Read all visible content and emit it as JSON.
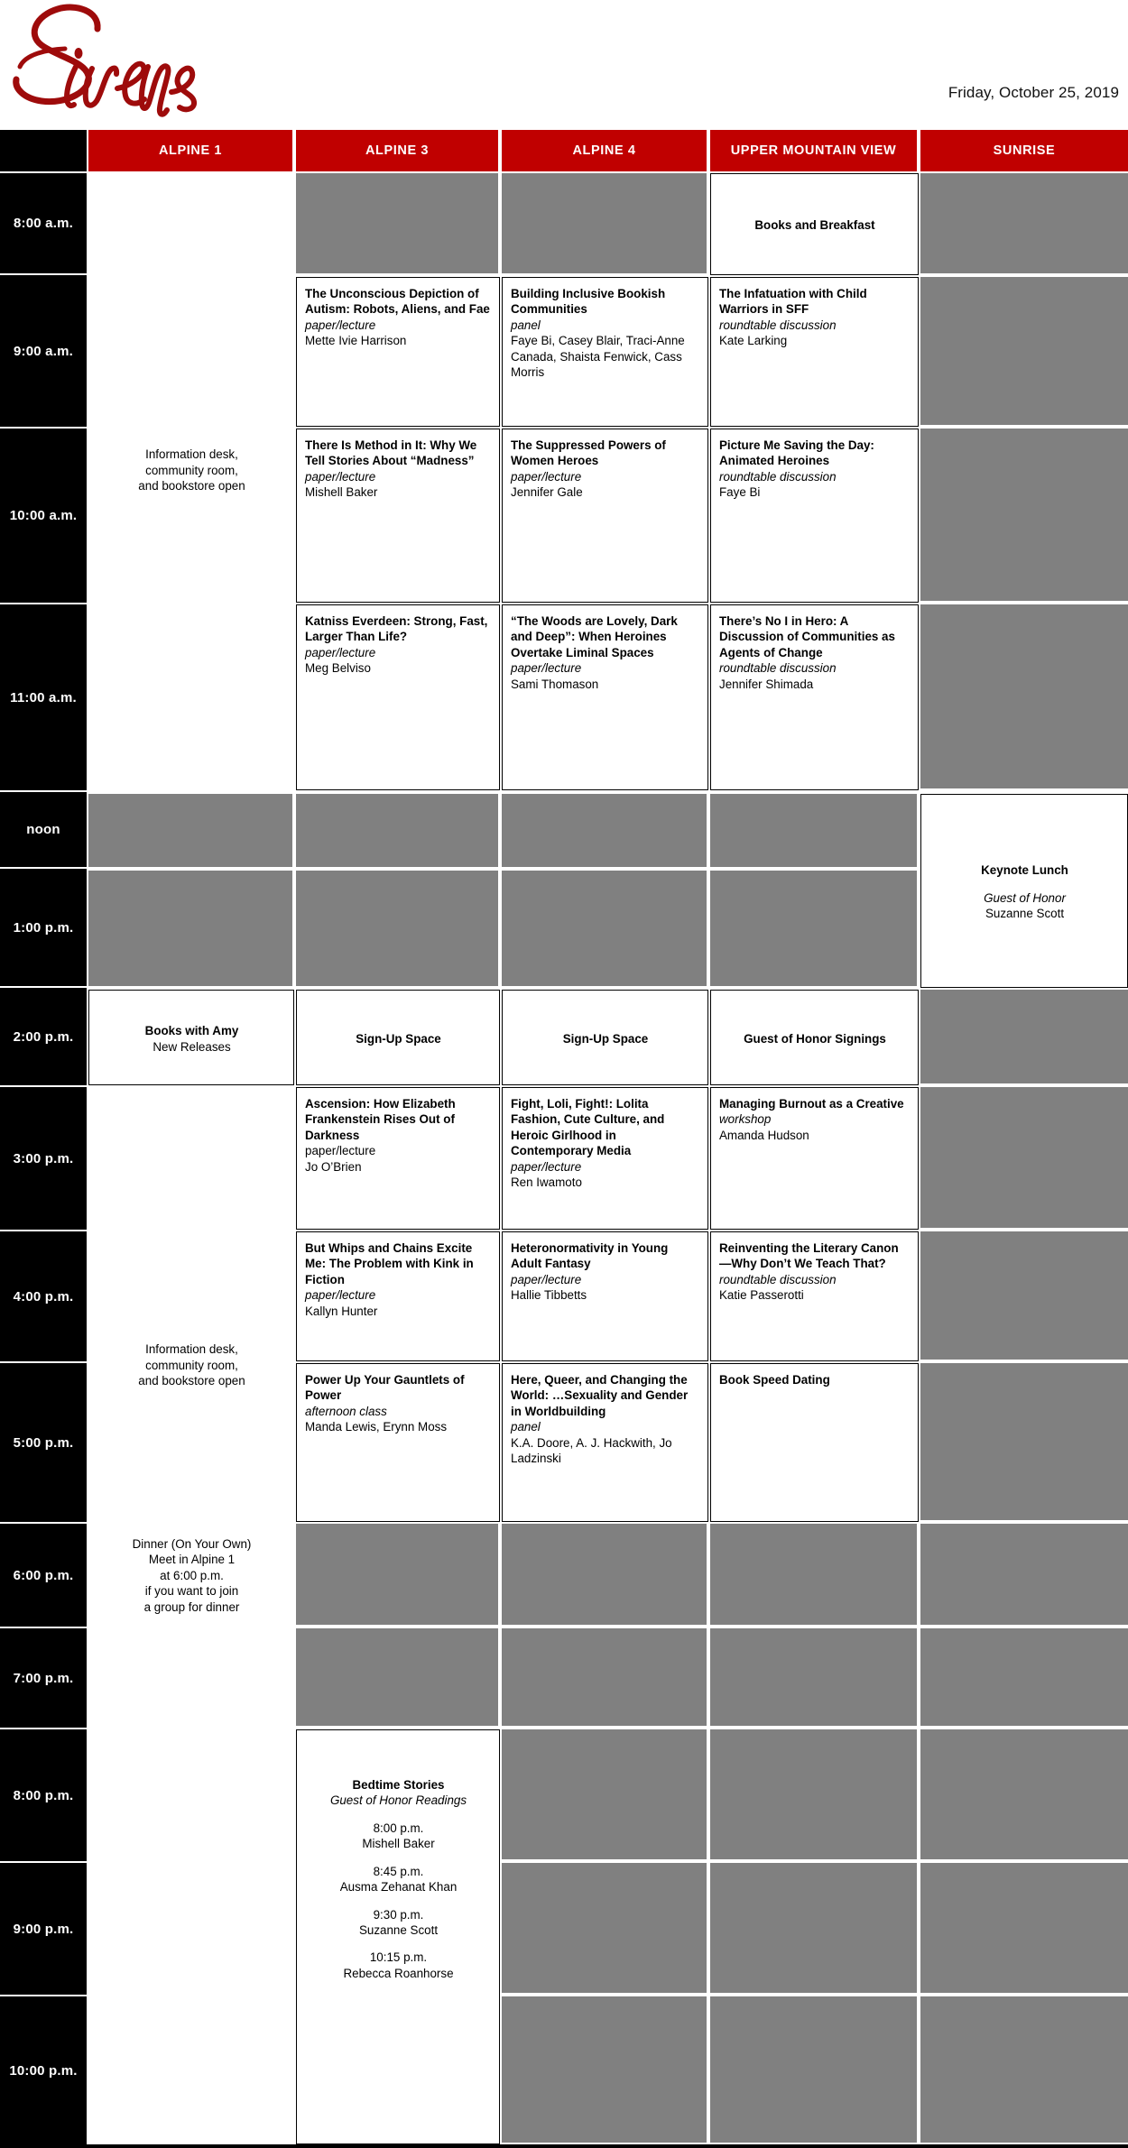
{
  "brand": {
    "logo_text": "Sirens",
    "logo_color": "#9e0b0b"
  },
  "header": {
    "date": "Friday, October 25, 2019",
    "accent_color": "#c00000",
    "time_col_color": "#000000",
    "empty_color": "#808080",
    "columns": [
      {
        "label": "ALPINE 1"
      },
      {
        "label": "ALPINE 3"
      },
      {
        "label": "ALPINE 4"
      },
      {
        "label": "UPPER MOUNTAIN VIEW"
      },
      {
        "label": "SUNRISE"
      }
    ]
  },
  "times": [
    {
      "label": "8:00 a.m."
    },
    {
      "label": "9:00 a.m."
    },
    {
      "label": "10:00 a.m."
    },
    {
      "label": "11:00 a.m."
    },
    {
      "label": "noon"
    },
    {
      "label": "1:00 p.m."
    },
    {
      "label": "2:00 p.m."
    },
    {
      "label": "3:00 p.m."
    },
    {
      "label": "4:00 p.m."
    },
    {
      "label": "5:00 p.m."
    },
    {
      "label": "6:00 p.m."
    },
    {
      "label": "7:00 p.m."
    },
    {
      "label": "8:00 p.m."
    },
    {
      "label": "9:00 p.m."
    },
    {
      "label": "10:00 p.m."
    }
  ],
  "sessions": {
    "info_morning": {
      "line1": "Information desk,",
      "line2": "community room,",
      "line3": "and bookstore open"
    },
    "books_and_breakfast": {
      "title": "Books and Breakfast"
    },
    "unconscious_autism": {
      "title": "The Unconscious Depiction of Autism: Robots, Aliens, and Fae",
      "type": "paper/lecture",
      "people": "Mette Ivie Harrison"
    },
    "bookish_communities": {
      "title": "Building Inclusive Bookish Communities",
      "type": "panel",
      "people": "Faye Bi, Casey Blair, Traci-Anne Canada, Shaista Fenwick, Cass Morris"
    },
    "child_warriors": {
      "title": "The Infatuation with Child Warriors in SFF",
      "type": "roundtable discussion",
      "people": "Kate Larking"
    },
    "method_in_it": {
      "title": "There Is Method in It: Why We Tell Stories About “Madness”",
      "type": "paper/lecture",
      "people": "Mishell Baker"
    },
    "suppressed_powers": {
      "title": "The Suppressed Powers of Women Heroes",
      "type": "paper/lecture",
      "people": "Jennifer Gale"
    },
    "animated_heroines": {
      "title": "Picture Me Saving the Day: Animated Heroines",
      "type": "roundtable discussion",
      "people": "Faye Bi"
    },
    "katniss": {
      "title": "Katniss Everdeen: Strong, Fast, Larger Than Life?",
      "type": "paper/lecture",
      "people": "Meg Belviso"
    },
    "woods_lovely": {
      "title": "“The Woods are Lovely, Dark and Deep”: When Heroines Overtake Liminal Spaces",
      "type": "paper/lecture",
      "people": "Sami Thomason"
    },
    "no_i_in_hero": {
      "title": "There’s No I in Hero: A Discussion of Communities as Agents of Change",
      "type": "roundtable discussion",
      "people": "Jennifer Shimada"
    },
    "keynote_lunch": {
      "title": "Keynote Lunch",
      "type": "Guest of Honor",
      "people": "Suzanne Scott"
    },
    "books_with_amy": {
      "title": "Books with Amy",
      "subtitle": "New Releases"
    },
    "signup_alpine3": {
      "title": "Sign-Up Space"
    },
    "signup_alpine4": {
      "title": "Sign-Up Space"
    },
    "goh_signings": {
      "title": "Guest of Honor Signings"
    },
    "ascension": {
      "title": "Ascension: How Elizabeth Frankenstein Rises Out of Darkness",
      "type": "paper/lecture",
      "people": "Jo O’Brien"
    },
    "fight_loli": {
      "title": "Fight, Loli, Fight!: Lolita Fashion, Cute Culture, and Heroic Girlhood in Contemporary Media",
      "type": "paper/lecture",
      "people": "Ren Iwamoto"
    },
    "managing_burnout": {
      "title": "Managing Burnout as a Creative",
      "type": "workshop",
      "people": "Amanda Hudson"
    },
    "whips_chains": {
      "title": "But Whips and Chains Excite Me: The Problem with Kink in Fiction",
      "type": "paper/lecture",
      "people": "Kallyn Hunter"
    },
    "heteronormativity": {
      "title": "Heteronormativity in Young Adult Fantasy",
      "type": "paper/lecture",
      "people": "Hallie Tibbetts"
    },
    "reinventing_canon": {
      "title": "Reinventing the Literary Canon—Why Don’t We Teach That?",
      "type": "roundtable discussion",
      "people": "Katie Passerotti"
    },
    "power_up": {
      "title": "Power Up Your Gauntlets of Power",
      "type": "afternoon class",
      "people": "Manda Lewis, Erynn Moss"
    },
    "here_queer": {
      "title": "Here, Queer, and Changing the World: …Sexuality and Gender in Worldbuilding",
      "type": "panel",
      "people": "K.A. Doore, A. J. Hackwith, Jo Ladzinski"
    },
    "book_speed_dating": {
      "title": "Book Speed Dating"
    },
    "info_afternoon": {
      "line1": "Information desk,",
      "line2": "community room,",
      "line3": "and bookstore open"
    },
    "dinner": {
      "line1": "Dinner (On Your Own)",
      "line2": "Meet in Alpine 1",
      "line3": "at 6:00 p.m.",
      "line4": "if you want to join",
      "line5": "a group for dinner"
    },
    "bedtime_stories": {
      "title": "Bedtime Stories",
      "subtitle": "Guest of Honor Readings",
      "slots": [
        {
          "time": "8:00 p.m.",
          "reader": "Mishell Baker"
        },
        {
          "time": "8:45 p.m.",
          "reader": "Ausma Zehanat Khan"
        },
        {
          "time": "9:30 p.m.",
          "reader": "Suzanne Scott"
        },
        {
          "time": "10:15 p.m.",
          "reader": "Rebecca Roanhorse"
        }
      ]
    }
  }
}
